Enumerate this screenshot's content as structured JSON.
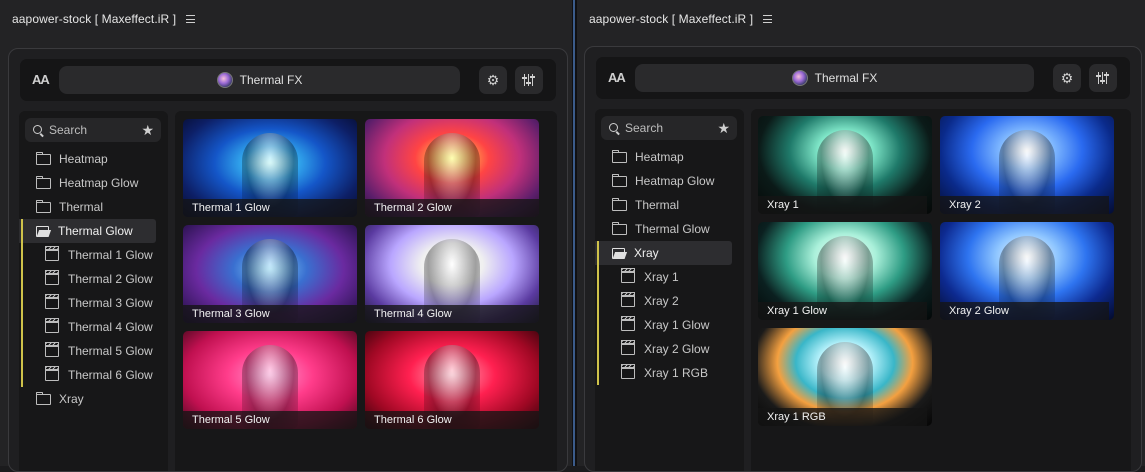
{
  "left_panel": {
    "tab_title": "aapower-stock [ Maxeffect.iR ]",
    "text_size_label": "AA",
    "category_select": "Thermal FX",
    "search_placeholder": "Search",
    "tree": [
      {
        "label": "Heatmap",
        "type": "folder"
      },
      {
        "label": "Heatmap Glow",
        "type": "folder"
      },
      {
        "label": "Thermal",
        "type": "folder"
      },
      {
        "label": "Thermal Glow",
        "type": "folder-open",
        "selected": true
      },
      {
        "label": "Thermal 1 Glow",
        "type": "preset"
      },
      {
        "label": "Thermal 2 Glow",
        "type": "preset"
      },
      {
        "label": "Thermal 3 Glow",
        "type": "preset"
      },
      {
        "label": "Thermal 4 Glow",
        "type": "preset"
      },
      {
        "label": "Thermal 5 Glow",
        "type": "preset"
      },
      {
        "label": "Thermal 6 Glow",
        "type": "preset"
      },
      {
        "label": "Xray",
        "type": "folder"
      }
    ],
    "thumbnails": [
      {
        "label": "Thermal 1 Glow"
      },
      {
        "label": "Thermal 2 Glow"
      },
      {
        "label": "Thermal 3 Glow"
      },
      {
        "label": "Thermal 4 Glow"
      },
      {
        "label": "Thermal 5 Glow"
      },
      {
        "label": "Thermal 6 Glow"
      }
    ]
  },
  "right_panel": {
    "tab_title": "aapower-stock [ Maxeffect.iR ]",
    "text_size_label": "AA",
    "category_select": "Thermal FX",
    "search_placeholder": "Search",
    "tree": [
      {
        "label": "Heatmap",
        "type": "folder"
      },
      {
        "label": "Heatmap Glow",
        "type": "folder"
      },
      {
        "label": "Thermal",
        "type": "folder"
      },
      {
        "label": "Thermal Glow",
        "type": "folder"
      },
      {
        "label": "Xray",
        "type": "folder-open",
        "selected": true
      },
      {
        "label": "Xray 1",
        "type": "preset"
      },
      {
        "label": "Xray 2",
        "type": "preset"
      },
      {
        "label": "Xray 1 Glow",
        "type": "preset"
      },
      {
        "label": "Xray 2 Glow",
        "type": "preset"
      },
      {
        "label": "Xray 1 RGB",
        "type": "preset"
      }
    ],
    "thumbnails": [
      {
        "label": "Xray 1"
      },
      {
        "label": "Xray 2"
      },
      {
        "label": "Xray 1 Glow"
      },
      {
        "label": "Xray 2 Glow"
      },
      {
        "label": "Xray 1 RGB"
      }
    ]
  },
  "icons": {
    "menu": "hamburger-icon",
    "text_size": "text-size-icon",
    "category": "thermal-fx-icon",
    "settings": "gear-icon",
    "adjust": "sliders-icon",
    "search": "search-icon",
    "favorite": "star-icon",
    "folder": "folder-icon",
    "folder_open": "folder-open-icon",
    "preset": "clapperboard-icon"
  },
  "colors": {
    "background": "#1b1b1d",
    "panel": "#232325",
    "sidebar": "#171718",
    "selected_row": "#2d2d30",
    "open_folder_bar": "#cfc24a",
    "panel_divider": "#3b5b8a"
  }
}
